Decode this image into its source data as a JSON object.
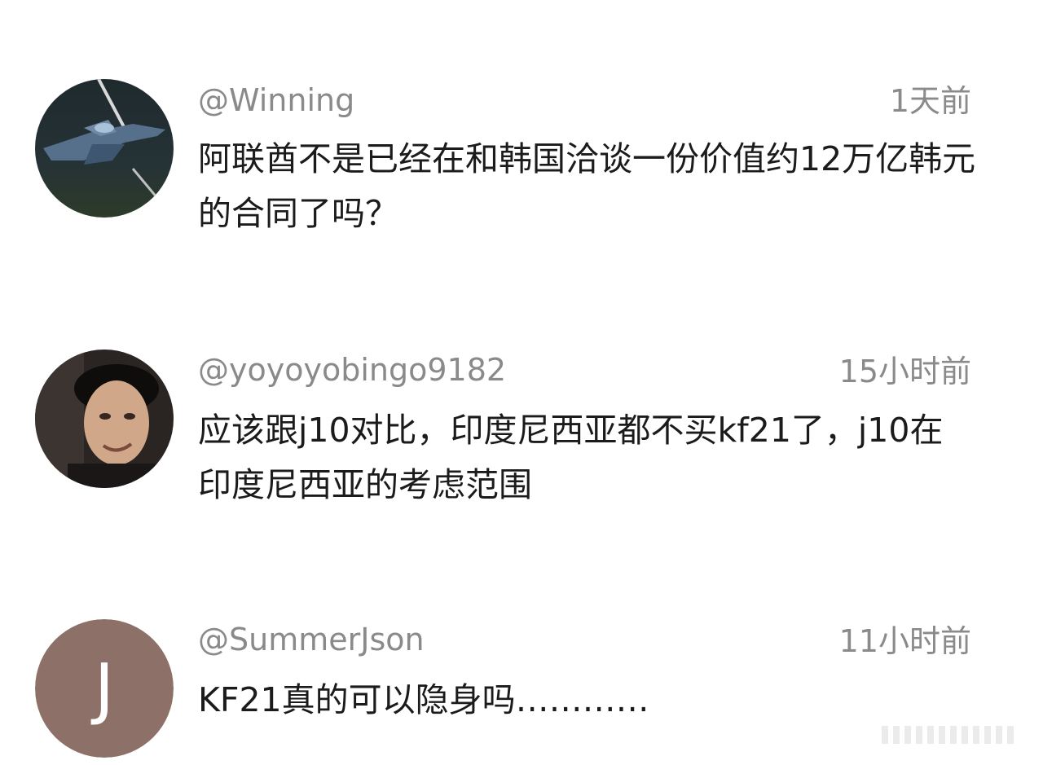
{
  "comments": [
    {
      "username": "@Winning",
      "time": "1天前",
      "text": "阿联酋不是已经在和韩国洽谈一份价值约12万亿韩元的合同了吗？",
      "avatar_icon": "jet-photo-avatar"
    },
    {
      "username": "@yoyoyobingo9182",
      "time": "15小时前",
      "text": "应该跟j10对比，印度尼西亚都不买kf21了，j10在印度尼西亚的考虑范围",
      "avatar_icon": "person-photo-avatar"
    },
    {
      "username": "@SummerJson",
      "time": "11小时前",
      "text": "KF21真的可以隐身吗…………",
      "avatar_letter": "J",
      "avatar_color": "#8d7168"
    }
  ]
}
